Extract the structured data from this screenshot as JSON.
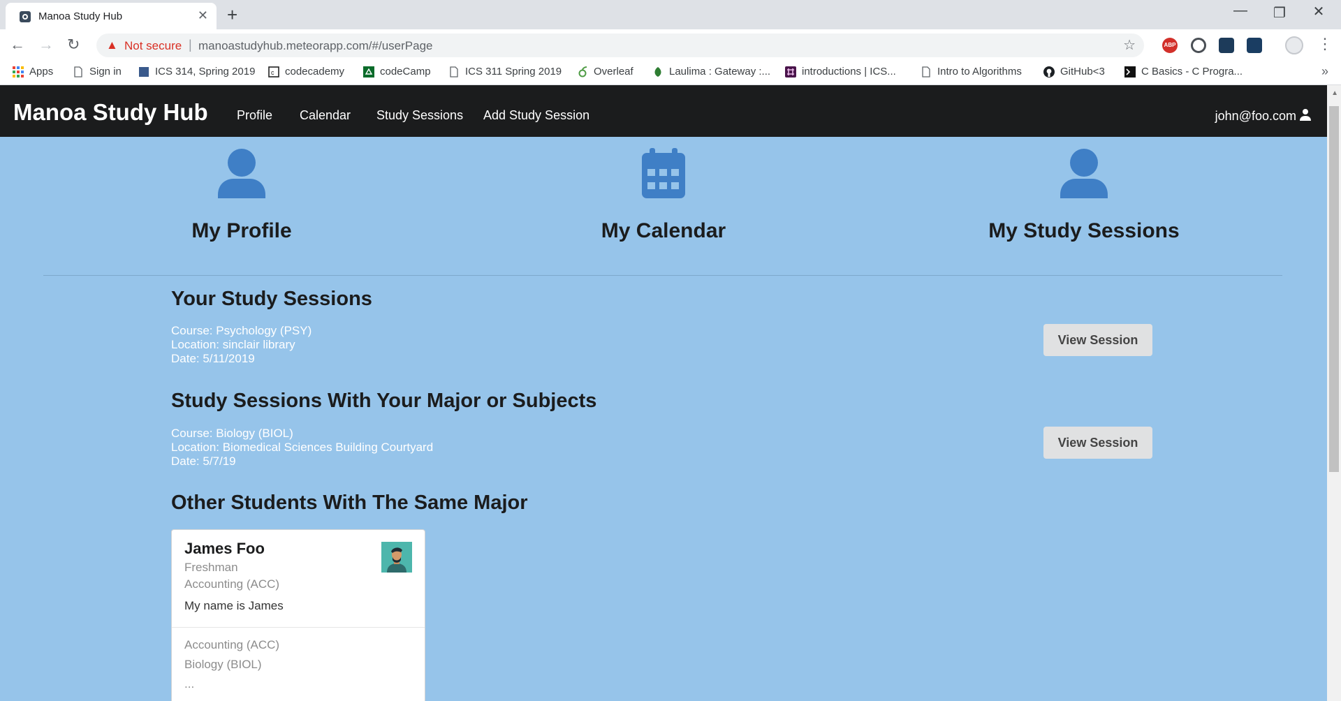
{
  "browser": {
    "tab_title": "Manoa Study Hub",
    "tab_close": "✕",
    "new_tab": "+",
    "window_controls": {
      "minimize": "—",
      "restore": "❐",
      "close": "✕"
    },
    "security_label": "Not secure",
    "url_separator": "|",
    "url": "manoastudyhub.meteorapp.com/#/userPage",
    "bookmarks": [
      {
        "label": "Apps",
        "icon": "apps-grid-icon"
      },
      {
        "label": "Sign in",
        "icon": "page-icon"
      },
      {
        "label": "ICS 314, Spring 2019",
        "icon": "square-icon"
      },
      {
        "label": "codecademy",
        "icon": "codecademy-icon"
      },
      {
        "label": "codeCamp",
        "icon": "codecamp-icon"
      },
      {
        "label": "ICS 311 Spring 2019",
        "icon": "page-icon"
      },
      {
        "label": "Overleaf",
        "icon": "overleaf-icon"
      },
      {
        "label": "Laulima : Gateway :...",
        "icon": "leaf-icon"
      },
      {
        "label": "introductions | ICS...",
        "icon": "slack-icon"
      },
      {
        "label": "Intro to Algorithms",
        "icon": "page-icon"
      },
      {
        "label": "GitHub<3",
        "icon": "github-icon"
      },
      {
        "label": "C Basics - C Progra...",
        "icon": "terminal-icon"
      }
    ],
    "bookmarks_more": "»",
    "abp_label": "ABP"
  },
  "navbar": {
    "brand": "Manoa Study Hub",
    "items": [
      "Profile",
      "Calendar",
      "Study Sessions",
      "Add Study Session"
    ],
    "user": "john@foo.com"
  },
  "features": [
    {
      "label": "My Profile",
      "icon": "user-icon"
    },
    {
      "label": "My Calendar",
      "icon": "calendar-icon"
    },
    {
      "label": "My Study Sessions",
      "icon": "user-icon"
    }
  ],
  "your_sessions": {
    "title": "Your Study Sessions",
    "course": "Course: Psychology (PSY)",
    "location": "Location: sinclair library",
    "date": "Date: 5/11/2019",
    "button": "View Session"
  },
  "major_sessions": {
    "title": "Study Sessions With Your Major or Subjects",
    "course": "Course: Biology (BIOL)",
    "location": "Location: Biomedical Sciences Building Courtyard",
    "date": "Date: 5/7/19",
    "button": "View Session"
  },
  "students": {
    "title": "Other Students With The Same Major",
    "card": {
      "name": "James Foo",
      "year": "Freshman",
      "major": "Accounting (ACC)",
      "bio": "My name is James",
      "subjects": [
        "Accounting (ACC)",
        "Biology (BIOL)",
        "..."
      ]
    }
  },
  "colors": {
    "page_bg": "#96c4ea",
    "navbar_bg": "#1b1c1d",
    "icon_blue": "#3f7fc6",
    "button_bg": "#e0e1e2"
  }
}
